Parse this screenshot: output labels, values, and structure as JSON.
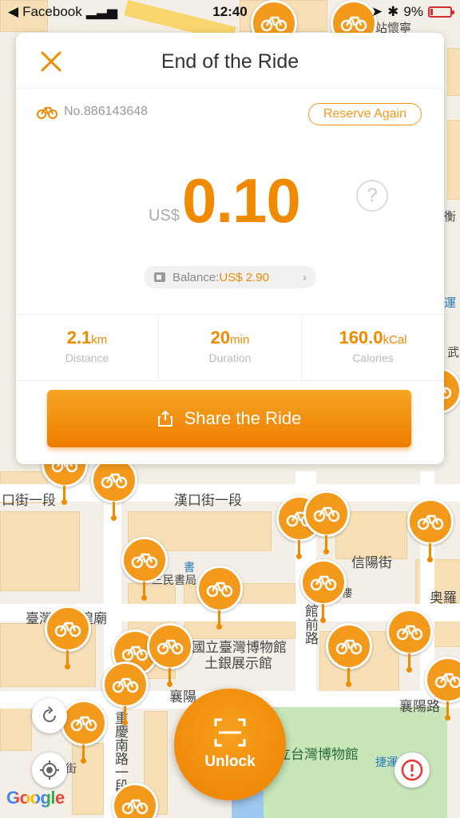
{
  "status_bar": {
    "carrier": "Facebook",
    "time": "12:40",
    "battery": "9%"
  },
  "card": {
    "title": "End of the Ride",
    "bike_number": "No.886143648",
    "reserve_label": "Reserve Again",
    "currency": "US$",
    "amount": "0.10",
    "help_symbol": "?",
    "balance_label": "Balance:",
    "balance_value": "US$ 2.90",
    "stats": [
      {
        "value": "2.1",
        "unit": "km",
        "label": "Distance"
      },
      {
        "value": "20",
        "unit": "min",
        "label": "Duration"
      },
      {
        "value": "160.0",
        "unit": "kCal",
        "label": "Calories"
      }
    ],
    "share_label": "Share the Ride"
  },
  "map": {
    "labels": [
      "漢口街一段",
      "口街一段",
      "信陽街",
      "三民書局",
      "臺灣",
      "隍廟",
      "國立臺灣博物館",
      "土銀展示館",
      "館前路",
      "襄陽",
      "襄陽路",
      "重慶南路一段",
      "國立台灣博物館",
      "捷運",
      "奥羅",
      "站懷寧",
      "運",
      "衡",
      "書",
      "街",
      "樓",
      "武"
    ],
    "brand": "Google"
  },
  "controls": {
    "unlock_label": "Unlock"
  },
  "colors": {
    "accent": "#f08a00",
    "accent_light": "#f5a623"
  }
}
